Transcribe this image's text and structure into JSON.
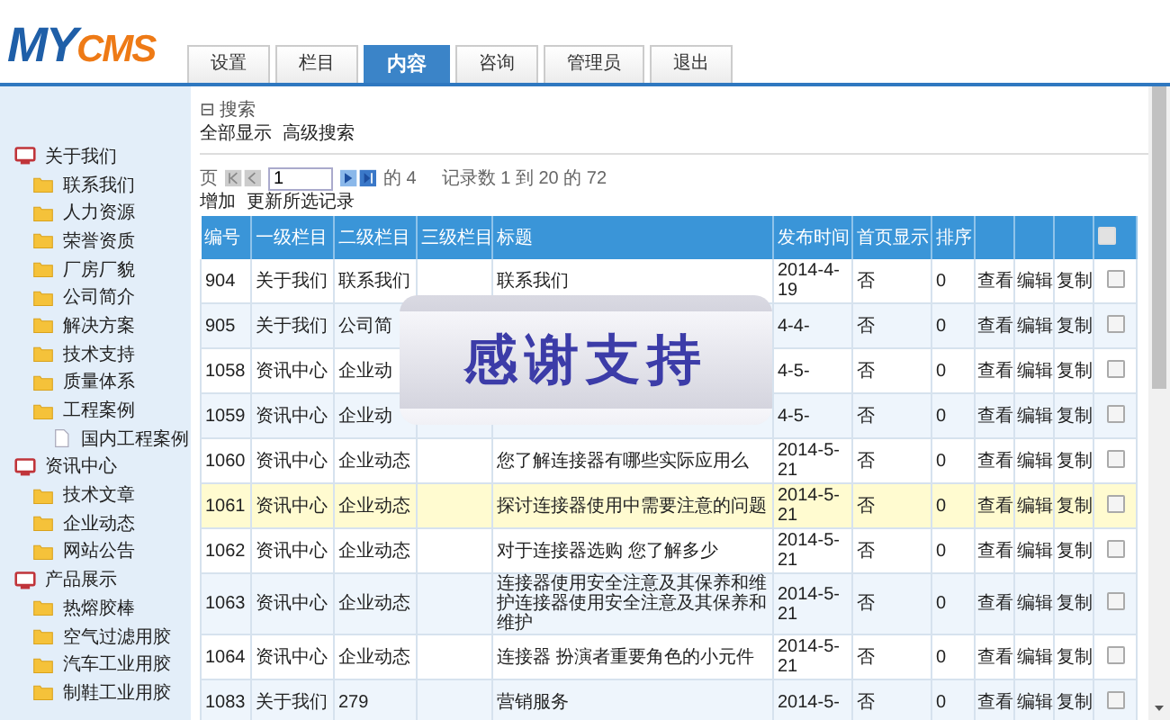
{
  "logo": {
    "main": "MY",
    "accent": "CMS"
  },
  "tabs": [
    {
      "label": "设置",
      "selected": false
    },
    {
      "label": "栏目",
      "selected": false
    },
    {
      "label": "内容",
      "selected": true
    },
    {
      "label": "咨询",
      "selected": false
    },
    {
      "label": "管理员",
      "selected": false
    },
    {
      "label": "退出",
      "selected": false
    }
  ],
  "sidebar": {
    "items": [
      {
        "label": "关于我们",
        "children": [
          {
            "label": "联系我们"
          },
          {
            "label": "人力资源"
          },
          {
            "label": "荣誉资质"
          },
          {
            "label": "厂房厂貌"
          },
          {
            "label": "公司简介"
          },
          {
            "label": "解决方案"
          },
          {
            "label": "技术支持"
          },
          {
            "label": "质量体系"
          },
          {
            "label": "工程案例",
            "children": [
              {
                "label": "国内工程案例"
              }
            ]
          }
        ]
      },
      {
        "label": "资讯中心",
        "children": [
          {
            "label": "技术文章"
          },
          {
            "label": "企业动态"
          },
          {
            "label": "网站公告"
          }
        ]
      },
      {
        "label": "产品展示",
        "children": [
          {
            "label": "热熔胶棒"
          },
          {
            "label": "空气过滤用胶"
          },
          {
            "label": "汽车工业用胶"
          },
          {
            "label": "制鞋工业用胶"
          }
        ]
      }
    ]
  },
  "search": {
    "toggle": "⊟",
    "label": "搜索",
    "links": [
      "全部显示",
      "高级搜索"
    ]
  },
  "pager": {
    "label": "页",
    "page": "1",
    "of_pages": "的 4",
    "records": "记录数 1 到 20 的 72"
  },
  "actions": [
    "增加",
    "更新所选记录"
  ],
  "table": {
    "columns": [
      "编号",
      "一级栏目",
      "二级栏目",
      "三级栏目",
      "标题",
      "发布时间",
      "首页显示",
      "排序",
      "",
      "",
      "",
      ""
    ],
    "select_all": {
      "checked": false
    },
    "rows": [
      {
        "id": "904",
        "l1": "关于我们",
        "l2": "联系我们",
        "l3": "",
        "title": "联系我们",
        "date": "2014-4-19",
        "home": "否",
        "order": "0",
        "view": "查看",
        "edit": "编辑",
        "copy": "复制",
        "checked": false,
        "highlighted": false
      },
      {
        "id": "905",
        "l1": "关于我们",
        "l2": "公司简",
        "l3": "",
        "title": "",
        "date": "4-4-",
        "home": "否",
        "order": "0",
        "view": "查看",
        "edit": "编辑",
        "copy": "复制",
        "checked": false,
        "highlighted": false
      },
      {
        "id": "1058",
        "l1": "资讯中心",
        "l2": "企业动",
        "l3": "",
        "title": "",
        "date": "4-5-",
        "home": "否",
        "order": "0",
        "view": "查看",
        "edit": "编辑",
        "copy": "复制",
        "checked": false,
        "highlighted": false
      },
      {
        "id": "1059",
        "l1": "资讯中心",
        "l2": "企业动",
        "l3": "",
        "title": "",
        "date": "4-5-",
        "home": "否",
        "order": "0",
        "view": "查看",
        "edit": "编辑",
        "copy": "复制",
        "checked": false,
        "highlighted": false
      },
      {
        "id": "1060",
        "l1": "资讯中心",
        "l2": "企业动态",
        "l3": "",
        "title": "您了解连接器有哪些实际应用么",
        "date": "2014-5-21",
        "home": "否",
        "order": "0",
        "view": "查看",
        "edit": "编辑",
        "copy": "复制",
        "checked": false,
        "highlighted": false
      },
      {
        "id": "1061",
        "l1": "资讯中心",
        "l2": "企业动态",
        "l3": "",
        "title": "探讨连接器使用中需要注意的问题",
        "date": "2014-5-21",
        "home": "否",
        "order": "0",
        "view": "查看",
        "edit": "编辑",
        "copy": "复制",
        "checked": false,
        "highlighted": true
      },
      {
        "id": "1062",
        "l1": "资讯中心",
        "l2": "企业动态",
        "l3": "",
        "title": "对于连接器选购 您了解多少",
        "date": "2014-5-21",
        "home": "否",
        "order": "0",
        "view": "查看",
        "edit": "编辑",
        "copy": "复制",
        "checked": false,
        "highlighted": false
      },
      {
        "id": "1063",
        "l1": "资讯中心",
        "l2": "企业动态",
        "l3": "",
        "title": "连接器使用安全注意及其保养和维护连接器使用安全注意及其保养和维护",
        "date": "2014-5-21",
        "home": "否",
        "order": "0",
        "view": "查看",
        "edit": "编辑",
        "copy": "复制",
        "checked": false,
        "highlighted": false
      },
      {
        "id": "1064",
        "l1": "资讯中心",
        "l2": "企业动态",
        "l3": "",
        "title": "连接器 扮演者重要角色的小元件",
        "date": "2014-5-21",
        "home": "否",
        "order": "0",
        "view": "查看",
        "edit": "编辑",
        "copy": "复制",
        "checked": false,
        "highlighted": false
      },
      {
        "id": "1083",
        "l1": "关于我们",
        "l2": "279",
        "l3": "",
        "title": "营销服务",
        "date": "2014-5-",
        "home": "否",
        "order": "0",
        "view": "查看",
        "edit": "编辑",
        "copy": "复制",
        "checked": false,
        "highlighted": false
      }
    ]
  },
  "banner": {
    "text": "感谢支持"
  }
}
